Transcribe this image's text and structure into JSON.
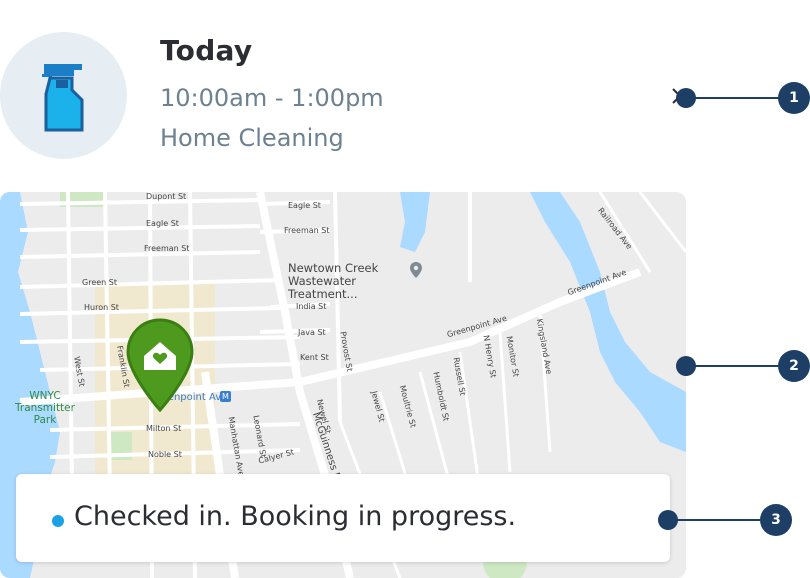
{
  "booking": {
    "title": "Today",
    "time": "10:00am - 1:00pm",
    "service": "Home Cleaning"
  },
  "map": {
    "streets": {
      "dupont": "Dupont St",
      "eagle": "Eagle St",
      "freeman": "Freeman St",
      "green": "Green St",
      "huron": "Huron St",
      "india": "India St",
      "java": "Java St",
      "kent": "Kent St",
      "milton": "Milton St",
      "noble": "Noble St",
      "greenpoint_ave": "Greenpoint Ave",
      "greenpoint_ave_2": "Greenpoint Ave",
      "manhattan_ave": "Manhattan Ave",
      "mcguinness": "McGuinness Bl",
      "franklin": "Franklin St",
      "west": "West St",
      "provost": "Provost St",
      "newel": "Newel St",
      "jewel": "Jewel St",
      "moultrie": "Moultrie St",
      "humboldt": "Humboldt St",
      "russell": "Russell St",
      "n_henry": "N Henry St",
      "monitor": "Monitor St",
      "kingsland": "Kingsland Ave",
      "railroad": "Railroad Ave",
      "leonard": "Leonard St",
      "calyer": "Calyer St"
    },
    "poi_wastewater": "Newtown Creek Wastewater Treatment...",
    "park_label": "WNYC Transmitter Park",
    "subway_label": "Greenpoint Av",
    "subway_badge": "M"
  },
  "status": {
    "text": "Checked in. Booking in progress."
  },
  "callouts": [
    "1",
    "2",
    "3"
  ],
  "colors": {
    "callout": "#1d3f66",
    "status_dot": "#1aa2e6",
    "pin": "#4e9a1e",
    "water": "#aadaff"
  }
}
